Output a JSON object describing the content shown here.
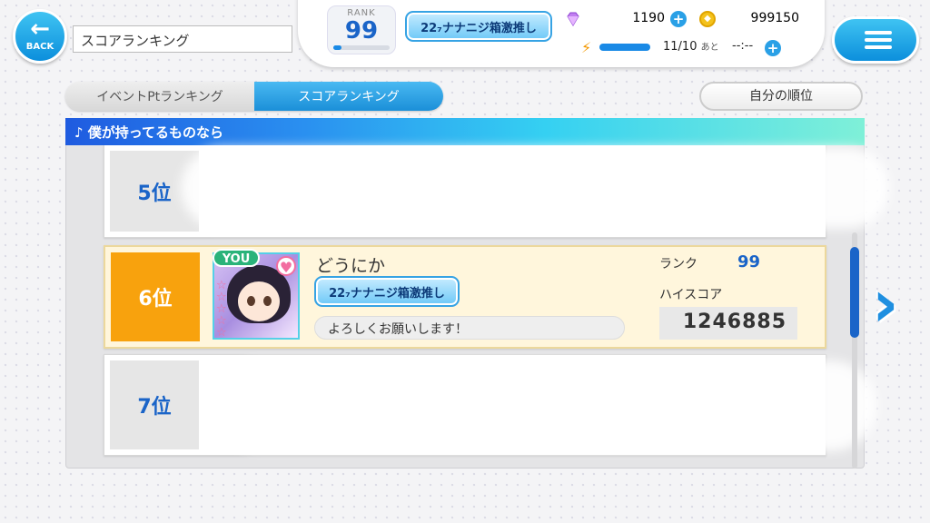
{
  "header": {
    "back_label": "BACK",
    "back_icon": "arrow-left-icon",
    "screen_title": "スコアランキング",
    "rank_label": "RANK",
    "rank_value": "99",
    "rank_progress": 0.15,
    "title_badge": "22₇ナナニジ箱激推し",
    "gem_count": "1190",
    "coin_count": "999150",
    "stamina_text": "11/10",
    "stamina_suffix": "あと",
    "stamina_timer": "--:--",
    "stamina_progress": 1.0
  },
  "tabs": [
    {
      "label": "イベントPtランキング",
      "active": false
    },
    {
      "label": "スコアランキング",
      "active": true
    }
  ],
  "my_rank_button": "自分の順位",
  "song_title": "♪ 僕が持ってるものなら",
  "rows": [
    {
      "rank": "5位"
    },
    {
      "rank": "6位",
      "you_label": "YOU",
      "name": "どうにか",
      "title_badge": "22₇ナナニジ箱激推し",
      "comment": "よろしくお願いします！",
      "rank_label": "ランク",
      "rank_value": "99",
      "score_label": "ハイスコア",
      "score": "1246885"
    },
    {
      "rank": "7位"
    }
  ],
  "colors": {
    "accent": "#1a8ae6",
    "my_rank_cell": "#f8a20d",
    "you_badge": "#2ab37a",
    "my_row_bg": "#fff6dc"
  }
}
